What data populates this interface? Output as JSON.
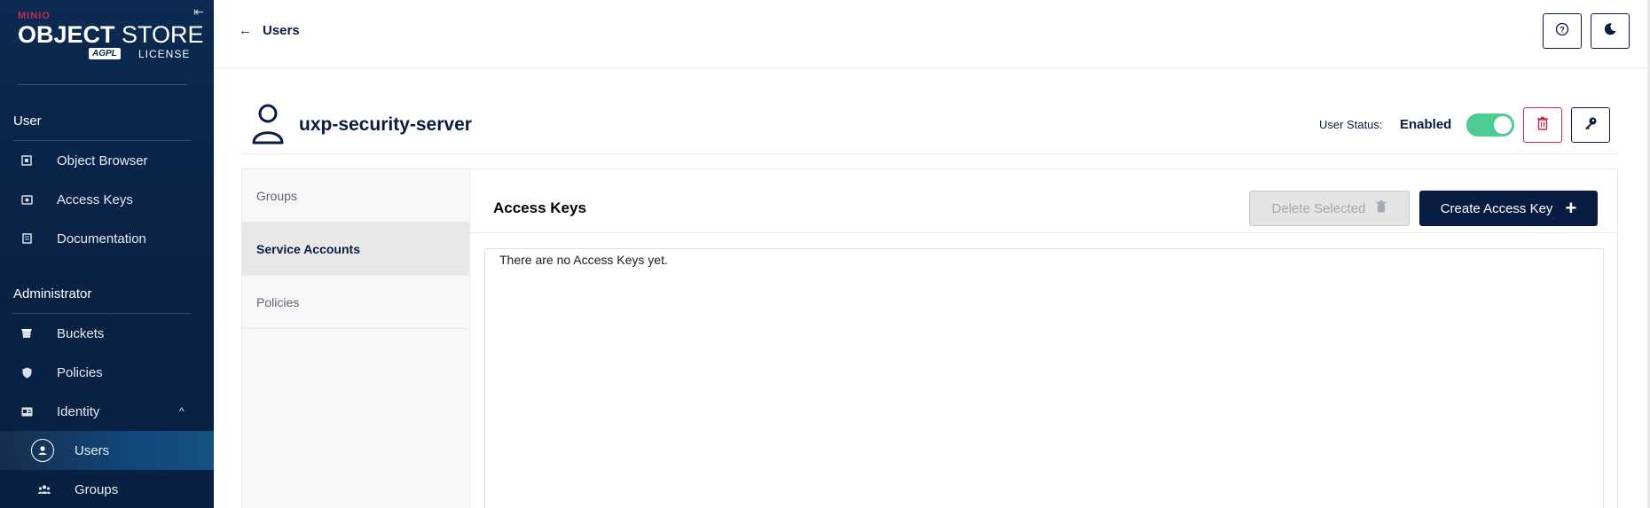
{
  "brand": {
    "minio": "MINIO",
    "object": "OBJECT",
    "store": "STORE",
    "agpl": "AGPL",
    "license": "LICENSE"
  },
  "sidebar": {
    "user_section": "User",
    "admin_section": "Administrator",
    "items": [
      {
        "label": "Object Browser",
        "icon": "object-browser-icon"
      },
      {
        "label": "Access Keys",
        "icon": "access-keys-icon"
      },
      {
        "label": "Documentation",
        "icon": "documentation-icon"
      },
      {
        "label": "Buckets",
        "icon": "buckets-icon"
      },
      {
        "label": "Policies",
        "icon": "policies-icon"
      },
      {
        "label": "Identity",
        "icon": "identity-icon"
      },
      {
        "label": "Users",
        "icon": "users-icon"
      },
      {
        "label": "Groups",
        "icon": "groups-icon"
      }
    ]
  },
  "topbar": {
    "back_label": "Users"
  },
  "user": {
    "name": "uxp-security-server",
    "status_label": "User Status:",
    "status_value": "Enabled",
    "enabled": true
  },
  "tabs": [
    {
      "label": "Groups",
      "active": false
    },
    {
      "label": "Service Accounts",
      "active": true
    },
    {
      "label": "Policies",
      "active": false
    }
  ],
  "access_keys": {
    "title": "Access Keys",
    "delete_selected_label": "Delete Selected",
    "create_label": "Create Access Key",
    "empty_message": "There are no Access Keys yet."
  },
  "colors": {
    "sidebar_bg": "#0a2347",
    "primary": "#081c42",
    "toggle_on": "#4ccb92",
    "danger": "#c72c48"
  }
}
